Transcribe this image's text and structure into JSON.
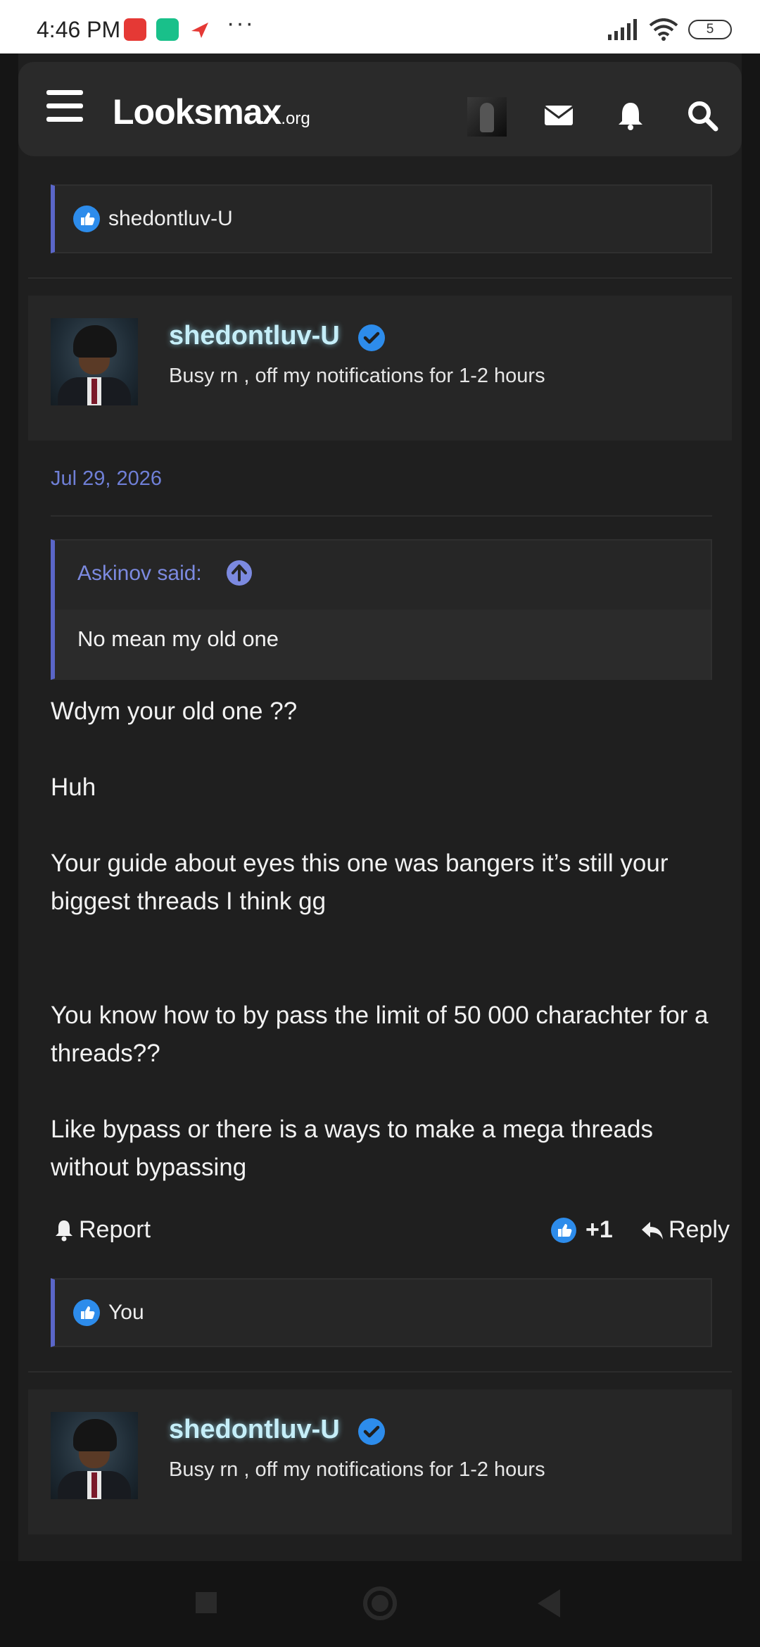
{
  "status_bar": {
    "time": "4:46 PM",
    "battery": "5",
    "dots": "···"
  },
  "nav": {
    "logo_main": "Lᴏᴏksmax",
    "logo_suffix": ".org",
    "icons": [
      "menu-icon",
      "avatar",
      "mail-icon",
      "bell-icon",
      "search-icon"
    ]
  },
  "top_likes": {
    "names": "shedontluv-U"
  },
  "post1": {
    "username": "shedontluv-U",
    "user_title": "Busy rn , off my notifications for 1-2 hours",
    "date": "Jul 29, 2026",
    "quote": {
      "author": "Askinov said:",
      "text": "No mean my old one"
    },
    "paragraphs": [
      "Wdym your old one ??",
      "Huh",
      "Your guide about eyes this one was bangers it’s still your biggest threads I think gg",
      "You know how to by pass the limit of 50 000 charachter for a threads??",
      "Like bypass or there is a ways to make a mega threads without bypassing"
    ],
    "report_label": "Report",
    "reaction_count": "+1",
    "reply_label": "Reply",
    "likes": "You"
  },
  "post2": {
    "username": "shedontluv-U",
    "user_title": "Busy rn , off my notifications for 1-2 hours"
  },
  "colors": {
    "accent": "#5a66c8",
    "link": "#6f7fd6",
    "like_blue": "#2d8ceb",
    "username_glow": "#c5eef8"
  }
}
